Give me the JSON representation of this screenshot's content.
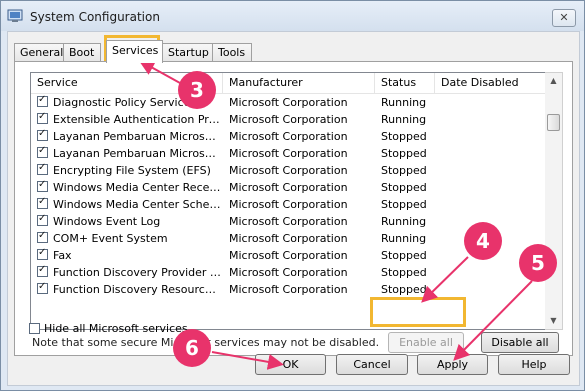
{
  "window": {
    "title": "System Configuration",
    "close_glyph": "✕"
  },
  "tabs": [
    {
      "label": "General",
      "active": false
    },
    {
      "label": "Boot",
      "active": false
    },
    {
      "label": "Services",
      "active": true
    },
    {
      "label": "Startup",
      "active": false
    },
    {
      "label": "Tools",
      "active": false
    }
  ],
  "services_table": {
    "columns": [
      "Service",
      "Manufacturer",
      "Status",
      "Date Disabled"
    ],
    "rows": [
      {
        "service": "Diagnostic Policy Service",
        "manufacturer": "Microsoft Corporation",
        "status": "Running",
        "date_disabled": "",
        "checked": true
      },
      {
        "service": "Extensible Authentication Protocol",
        "manufacturer": "Microsoft Corporation",
        "status": "Running",
        "date_disabled": "",
        "checked": true
      },
      {
        "service": "Layanan Pembaruan Microsoft E...",
        "manufacturer": "Microsoft Corporation",
        "status": "Stopped",
        "date_disabled": "",
        "checked": true
      },
      {
        "service": "Layanan Pembaruan Microsoft E...",
        "manufacturer": "Microsoft Corporation",
        "status": "Stopped",
        "date_disabled": "",
        "checked": true
      },
      {
        "service": "Encrypting File System (EFS)",
        "manufacturer": "Microsoft Corporation",
        "status": "Stopped",
        "date_disabled": "",
        "checked": true
      },
      {
        "service": "Windows Media Center Receiver...",
        "manufacturer": "Microsoft Corporation",
        "status": "Stopped",
        "date_disabled": "",
        "checked": true
      },
      {
        "service": "Windows Media Center Schedule...",
        "manufacturer": "Microsoft Corporation",
        "status": "Stopped",
        "date_disabled": "",
        "checked": true
      },
      {
        "service": "Windows Event Log",
        "manufacturer": "Microsoft Corporation",
        "status": "Running",
        "date_disabled": "",
        "checked": true
      },
      {
        "service": "COM+ Event System",
        "manufacturer": "Microsoft Corporation",
        "status": "Running",
        "date_disabled": "",
        "checked": true
      },
      {
        "service": "Fax",
        "manufacturer": "Microsoft Corporation",
        "status": "Stopped",
        "date_disabled": "",
        "checked": true
      },
      {
        "service": "Function Discovery Provider Host",
        "manufacturer": "Microsoft Corporation",
        "status": "Stopped",
        "date_disabled": "",
        "checked": true
      },
      {
        "service": "Function Discovery Resource Pu...",
        "manufacturer": "Microsoft Corporation",
        "status": "Stopped",
        "date_disabled": "",
        "checked": true
      }
    ]
  },
  "note": "Note that some secure Microsoft services may not be disabled.",
  "buttons": {
    "enable_all": "Enable all",
    "disable_all": "Disable all",
    "ok": "OK",
    "cancel": "Cancel",
    "apply": "Apply",
    "help": "Help"
  },
  "hide_ms": {
    "label": "Hide all Microsoft services",
    "checked": false
  },
  "callouts": {
    "services": "3",
    "enable_all": "4",
    "apply": "5",
    "ok": "6"
  },
  "colors": {
    "callout": "#e8336b",
    "highlight": "#f2b731"
  }
}
